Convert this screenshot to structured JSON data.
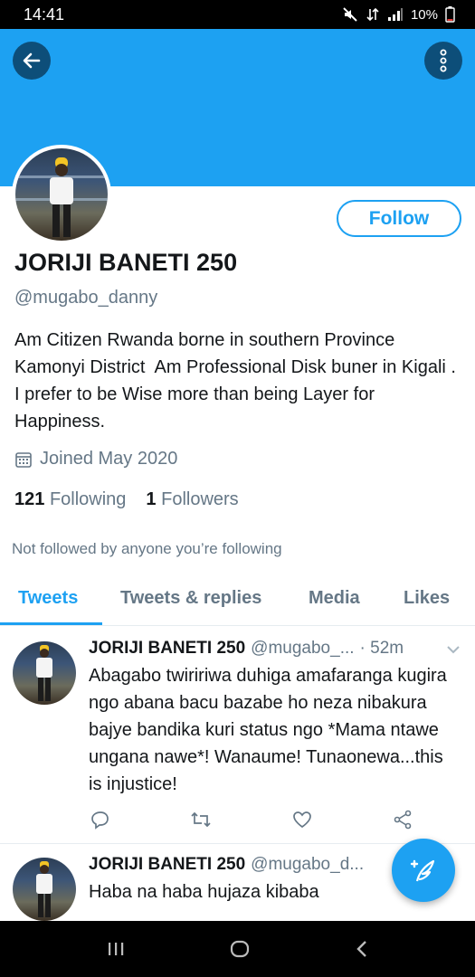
{
  "status_bar": {
    "time": "14:41",
    "battery": "10%"
  },
  "profile": {
    "name": "JORIJI BANETI 250",
    "handle": "@mugabo_danny",
    "bio": "Am Citizen Rwanda borne in southern Province Kamonyi District  Am Professional Disk buner in Kigali .  I prefer to be Wise more than being Layer for Happiness.",
    "joined": "Joined May 2020",
    "following_count": "121",
    "following_label": "Following",
    "followers_count": "1",
    "followers_label": "Followers",
    "not_followed_text": "Not followed by anyone you’re following",
    "follow_button": "Follow"
  },
  "colors": {
    "accent": "#1da1f2",
    "banner": "#1da1f2",
    "secondary_text": "#657786"
  },
  "tabs": [
    {
      "label": "Tweets",
      "active": true
    },
    {
      "label": "Tweets & replies",
      "active": false
    },
    {
      "label": "Media",
      "active": false
    },
    {
      "label": "Likes",
      "active": false
    }
  ],
  "tweets": [
    {
      "name": "JORIJI BANETI 250",
      "handle": "@mugabo_...",
      "time": "· 52m",
      "text": "Abagabo twiririwa duhiga  amafaranga kugira ngo abana bacu bazabe ho neza nibakura bajye bandika kuri status ngo *Mama ntawe ungana nawe*! Wanaume! Tunaonewa...this is injustice!"
    },
    {
      "name": "JORIJI BANETI 250",
      "handle": "@mugabo_d...",
      "time": "",
      "text": "Haba na haba hujaza kibaba"
    }
  ],
  "icons": {
    "back": "arrow-left-icon",
    "more": "more-vertical-icon",
    "calendar": "calendar-icon",
    "reply": "reply-icon",
    "retweet": "retweet-icon",
    "like": "heart-icon",
    "share": "share-icon",
    "compose": "compose-feather-icon"
  }
}
